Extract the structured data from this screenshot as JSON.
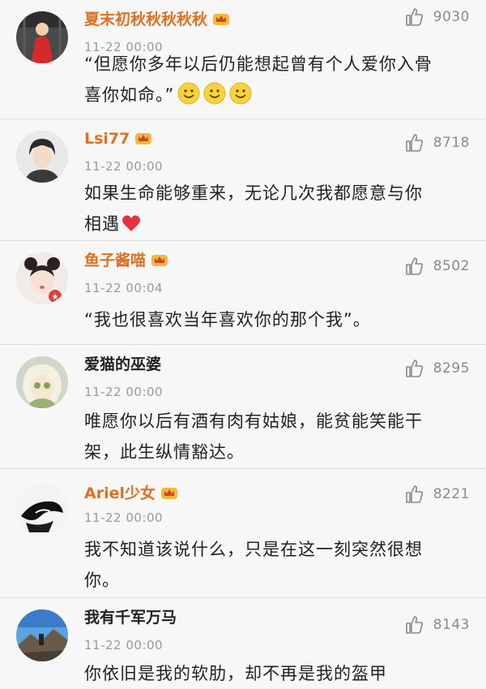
{
  "comments": [
    {
      "username": "夏末初秋秋秋秋秋",
      "vip": true,
      "time": "11-22 00:00",
      "likes": "9030",
      "text_line1": "“但愿你多年以后仍能想起曾有个人爱你入骨",
      "text_line2": "喜你如命。”",
      "avatar_icon": "avatar-red-dress-figure",
      "trailing_emoji": [
        "smile-emoji",
        "smile-emoji",
        "smile-emoji"
      ]
    },
    {
      "username": "Lsi77",
      "vip": true,
      "time": "11-22 00:00",
      "likes": "8718",
      "text_line1": "如果生命能够重来，无论几次我都愿意与你",
      "text_line2": "相遇",
      "avatar_icon": "avatar-boy-portrait",
      "trailing_emoji": [
        "red-heart-emoji"
      ]
    },
    {
      "username": "鱼子酱喵",
      "vip": true,
      "time": "11-22 00:04",
      "likes": "8502",
      "text_line1": "“我也很喜欢当年喜欢你的那个我”。",
      "avatar_icon": "avatar-girl-buns"
    },
    {
      "username": "爱猫的巫婆",
      "vip": false,
      "time": "11-22 00:00",
      "likes": "8295",
      "text_line1": "唯愿你以后有酒有肉有姑娘，能贫能笑能干",
      "text_line2": "架，此生纵情豁达。",
      "avatar_icon": "avatar-cartoon-girl"
    },
    {
      "username": "Ariel少女",
      "vip": true,
      "time": "11-22 00:00",
      "likes": "8221",
      "text_line1": "我不知道该说什么，只是在这一刻突然很想",
      "text_line2": "你。",
      "avatar_icon": "avatar-monochrome-face"
    },
    {
      "username": "我有千军万马",
      "vip": false,
      "time": "11-22 00:00",
      "likes": "8143",
      "text_line1": "你依旧是我的软肋，却不再是我的盔甲",
      "avatar_icon": "avatar-landscape-sky"
    }
  ],
  "colors": {
    "vip_name": "#e07020",
    "plain_name": "#222222",
    "meta": "#9a9a9a",
    "background": "#f7f7f7"
  }
}
